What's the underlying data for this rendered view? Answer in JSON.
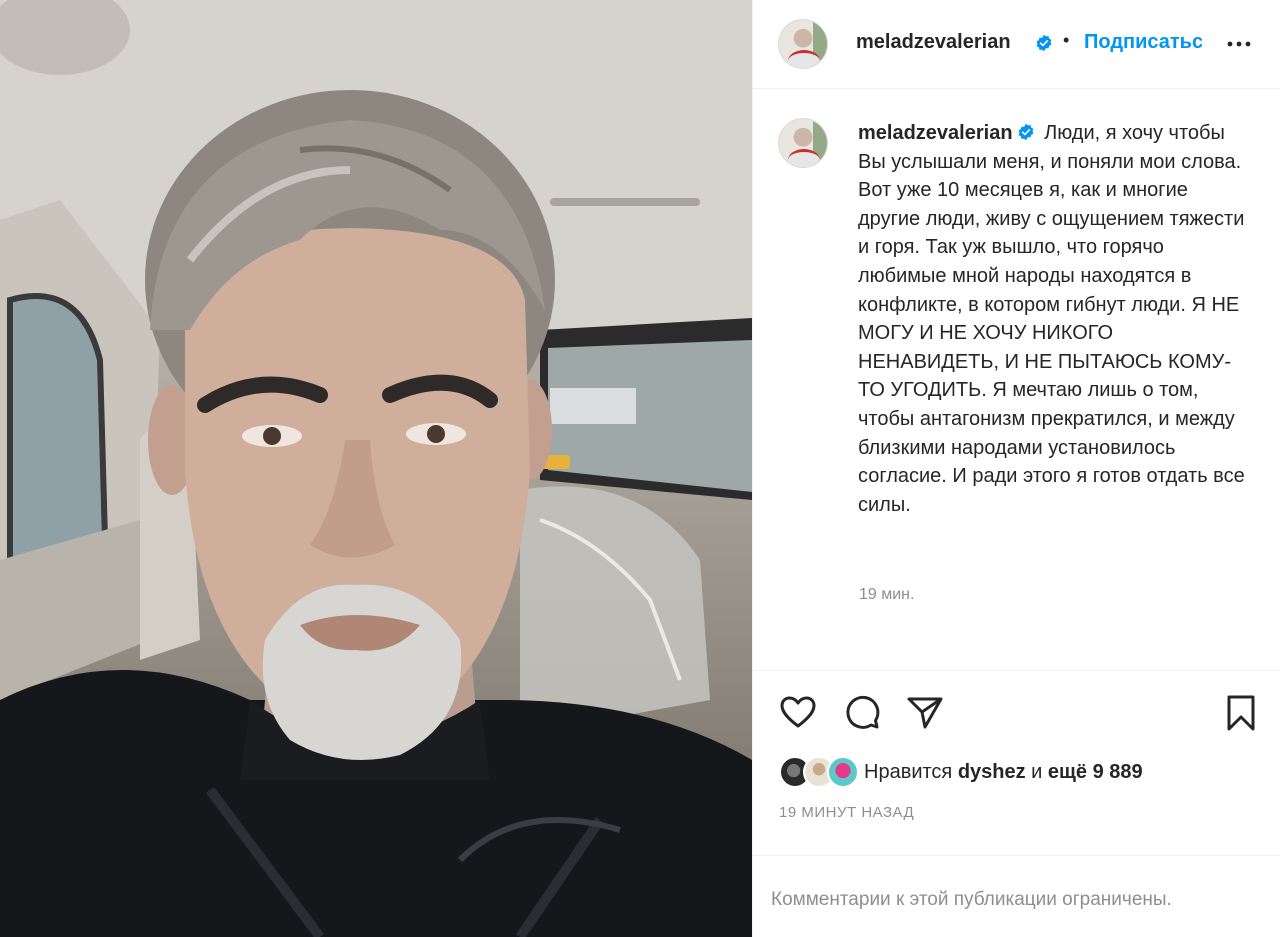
{
  "photo": {
    "alt": "selfie"
  },
  "header": {
    "username": "meladzevalerian",
    "separator": "•",
    "follow_label": "Подписаться",
    "more_icon": "more-horizontal-icon",
    "verified_color": "#0095f6"
  },
  "caption": {
    "username": "meladzevalerian",
    "text": "Люди, я хочу чтобы Вы услышали меня, и поняли мои слова. Вот уже 10 месяцев я, как и многие другие люди, живу с ощущением тяжести и горя. Так уж вышло, что горячо любимые мной народы находятся в конфликте, в котором гибнут люди. Я НЕ МОГУ И НЕ ХОЧУ НИКОГО НЕНАВИДЕТЬ, И НЕ ПЫТАЮСЬ КОМУ-ТО УГОДИТЬ. Я мечтаю лишь о том, чтобы антагонизм прекратился, и между близкими народами установилось согласие. И ради этого я готов отдать все силы.",
    "time": "19 мин."
  },
  "actions": {
    "like_icon": "heart-icon",
    "comment_icon": "comment-icon",
    "share_icon": "paper-plane-icon",
    "save_icon": "bookmark-icon"
  },
  "likes": {
    "prefix": "Нравится ",
    "user": "dyshez",
    "middle": " и ",
    "count": "ещё 9 889"
  },
  "post_age": "19 МИНУТ НАЗАД",
  "comments_limited": "Комментарии к этой публикации ограничены."
}
